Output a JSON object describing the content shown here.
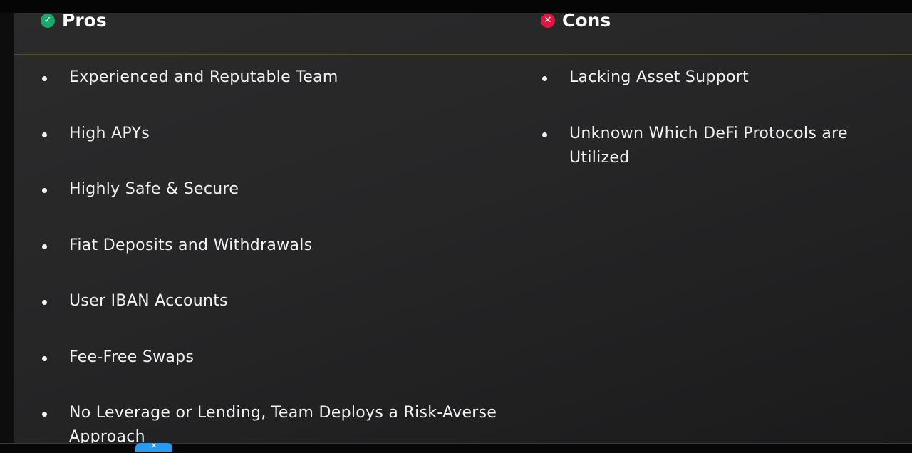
{
  "pros": {
    "heading": "Pros",
    "icon": "check-circle-icon",
    "icon_color": "#1aa86b",
    "items": [
      "Experienced and Reputable Team",
      "High APYs",
      "Highly Safe & Secure",
      "Fiat Deposits and Withdrawals",
      "User IBAN Accounts",
      "Fee-Free Swaps",
      "No Leverage or Lending, Team Deploys a Risk-Averse Approach"
    ]
  },
  "cons": {
    "heading": "Cons",
    "icon": "x-circle-icon",
    "icon_color": "#e2163f",
    "items": [
      "Lacking Asset Support",
      "Unknown Which DeFi Protocols are Utilized"
    ]
  },
  "footer_tab": {
    "icon": "close-icon",
    "color": "#2a9af0"
  },
  "colors": {
    "divider": "#5a4a2e",
    "text": "#f2f2f2"
  }
}
